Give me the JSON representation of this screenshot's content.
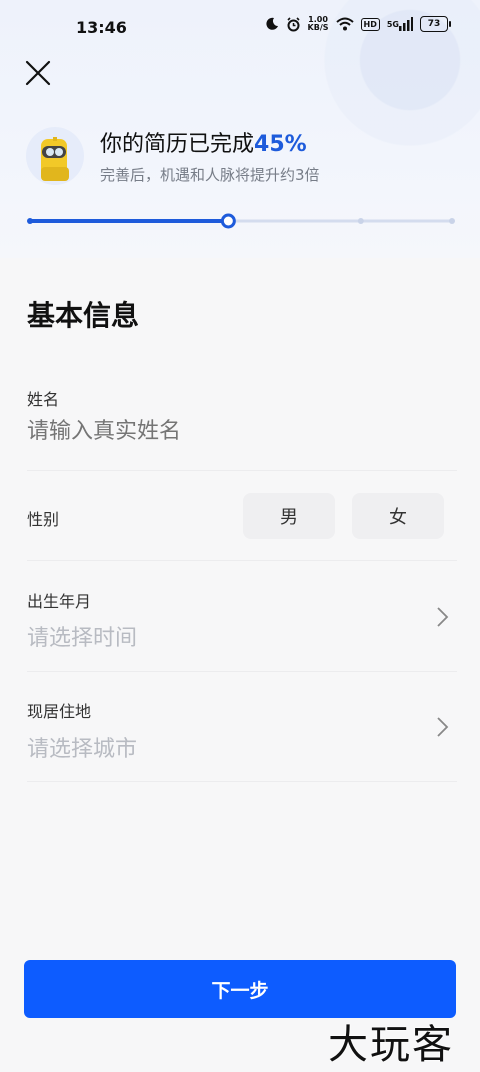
{
  "status_bar": {
    "time": "13:46",
    "net_speed_value": "1.00",
    "net_speed_unit": "KB/S",
    "hd": "HD",
    "signal_type": "5G",
    "battery": "73"
  },
  "header": {
    "title_prefix": "你的简历已完成",
    "title_percent": "45%",
    "subtitle": "完善后，机遇和人脉将提升约3倍",
    "progress": 0.47,
    "accent_color": "#1e5bdb"
  },
  "form": {
    "section_title": "基本信息",
    "name": {
      "label": "姓名",
      "placeholder": "请输入真实姓名"
    },
    "gender": {
      "label": "性别",
      "options": [
        "男",
        "女"
      ]
    },
    "birth": {
      "label": "出生年月",
      "placeholder": "请选择时间"
    },
    "residence": {
      "label": "现居住地",
      "placeholder": "请选择城市"
    }
  },
  "actions": {
    "next_label": "下一步",
    "button_color": "#0d5cff"
  },
  "watermark": "大玩客"
}
